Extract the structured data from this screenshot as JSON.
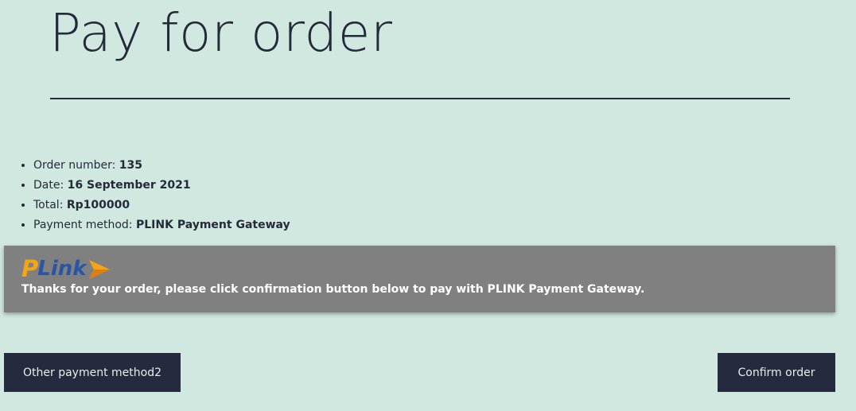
{
  "page": {
    "title": "Pay for order"
  },
  "order": {
    "items": [
      {
        "label": "Order number: ",
        "value": "135"
      },
      {
        "label": "Date: ",
        "value": "16 September 2021"
      },
      {
        "label": "Total: ",
        "value": "Rp100000"
      },
      {
        "label": "Payment method: ",
        "value": "PLINK Payment Gateway"
      }
    ]
  },
  "gateway": {
    "logo_text_p": "P",
    "logo_text_link": "Link",
    "message": "Thanks for your order, please click confirmation button below to pay with PLINK Payment Gateway.",
    "box_color": "#808080",
    "logo_colors": {
      "orange": "#f3a515",
      "blue": "#2b55a3"
    }
  },
  "actions": {
    "other_method_label": "Other payment method2",
    "confirm_label": "Confirm order"
  },
  "colors": {
    "background": "#d0e8df",
    "text": "#252a3a",
    "button_bg": "#252a3f"
  }
}
